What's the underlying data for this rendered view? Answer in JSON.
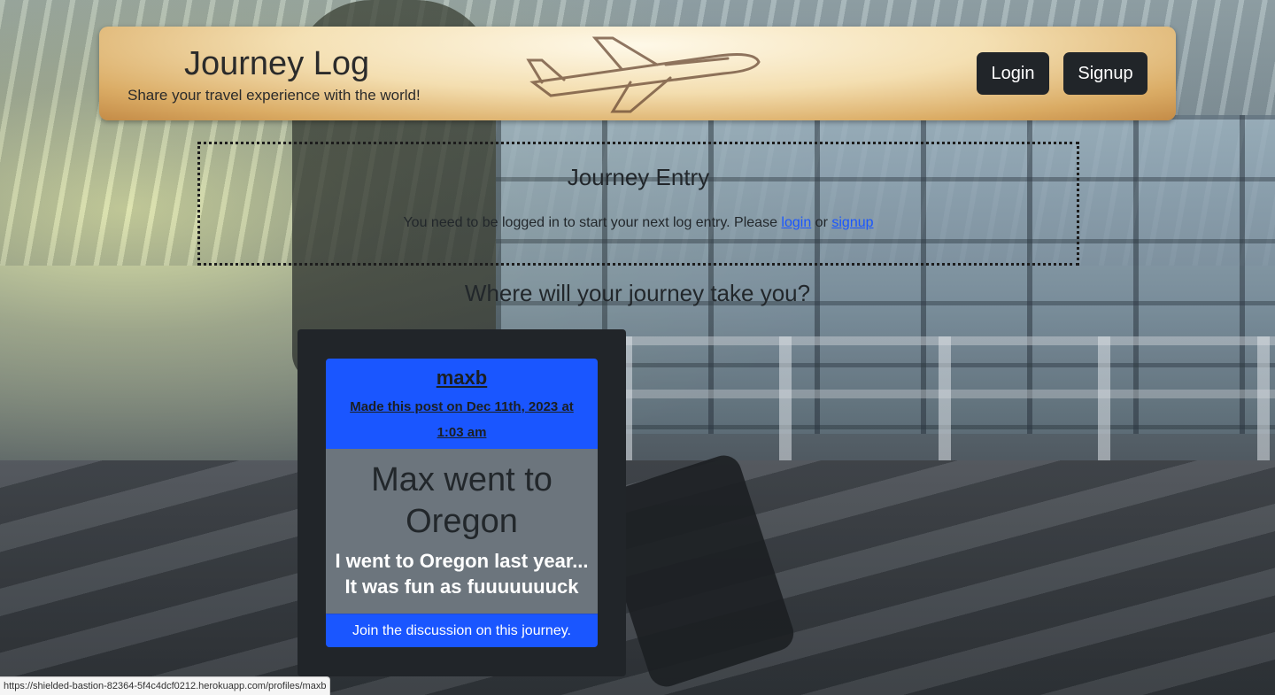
{
  "header": {
    "title": "Journey Log",
    "tagline": "Share your travel experience with the world!",
    "login_label": "Login",
    "signup_label": "Signup"
  },
  "entry": {
    "title": "Journey Entry",
    "message_prefix": "You need to be logged in to start your next log entry. Please ",
    "login_link": "login",
    "or_text": " or ",
    "signup_link": "signup"
  },
  "prompt": "Where will your journey take you?",
  "post": {
    "author": "maxb",
    "date_text": "Made this post on Dec 11th, 2023 at 1:03 am",
    "title": "Max went to Oregon",
    "body": "I went to Oregon last year... It was fun as fuuuuuuuck",
    "discussion_label": "Join the discussion on this journey."
  },
  "status_bar": {
    "url": "https://shielded-bastion-82364-5f4c4dcf0212.herokuapp.com/profiles/maxb"
  },
  "colors": {
    "primary_blue": "#1a56ff",
    "dark": "#212529",
    "card_gray": "#6c757d"
  }
}
